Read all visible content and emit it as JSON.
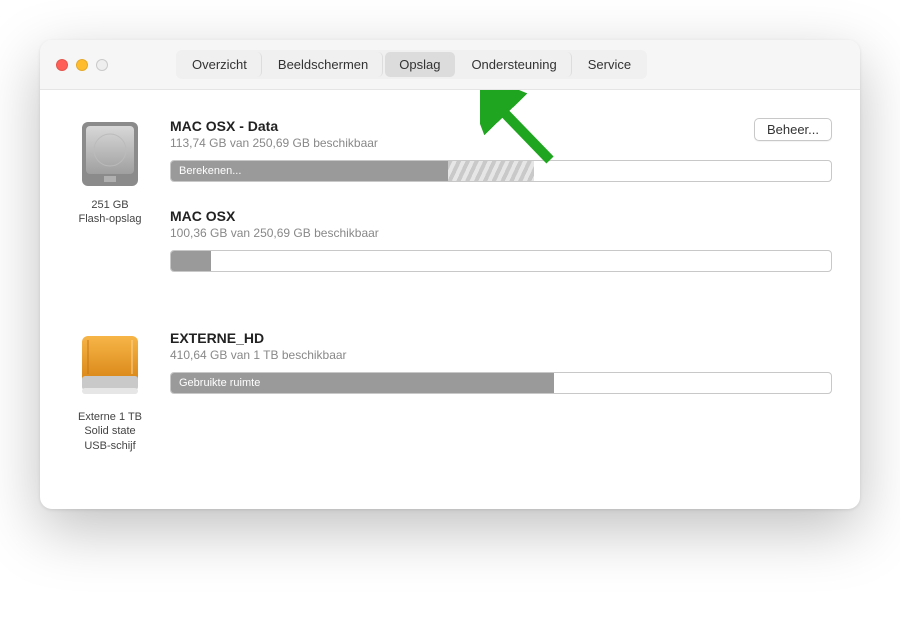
{
  "tabs": [
    "Overzicht",
    "Beeldschermen",
    "Opslag",
    "Ondersteuning",
    "Service"
  ],
  "activeTab": "Opslag",
  "manageLabel": "Beheer...",
  "drives": [
    {
      "iconType": "internal-ssd",
      "captionLine1": "251 GB",
      "captionLine2": "Flash-opslag",
      "volumes": [
        {
          "name": "MAC OSX - Data",
          "sub": "113,74 GB van 250,69 GB beschikbaar",
          "segments": [
            {
              "kind": "gray",
              "label": "Berekenen...",
              "width": 42
            },
            {
              "kind": "hatch",
              "width": 13
            }
          ],
          "hasManage": true
        },
        {
          "name": "MAC OSX",
          "sub": "100,36 GB van 250,69 GB beschikbaar",
          "segments": [
            {
              "kind": "gray",
              "width": 6
            }
          ],
          "hasManage": false
        }
      ]
    },
    {
      "iconType": "external-ssd",
      "captionLine1": "Externe 1 TB",
      "captionLine2": "Solid state",
      "captionLine3": "USB-schijf",
      "volumes": [
        {
          "name": "EXTERNE_HD",
          "sub": "410,64 GB van 1 TB beschikbaar",
          "segments": [
            {
              "kind": "gray",
              "label": "Gebruikte ruimte",
              "width": 58
            }
          ],
          "hasManage": false
        }
      ]
    }
  ]
}
